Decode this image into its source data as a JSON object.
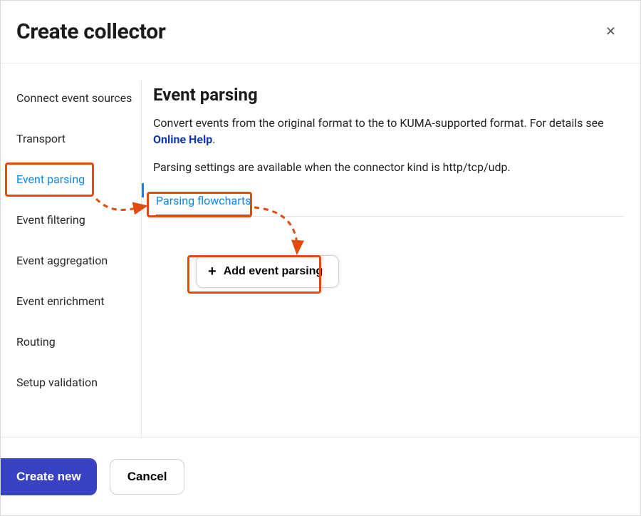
{
  "header": {
    "title": "Create collector",
    "close_label": "✕"
  },
  "sidebar": {
    "items": [
      {
        "label": "Connect event sources",
        "active": false
      },
      {
        "label": "Transport",
        "active": false
      },
      {
        "label": "Event parsing",
        "active": true
      },
      {
        "label": "Event filtering",
        "active": false
      },
      {
        "label": "Event aggregation",
        "active": false
      },
      {
        "label": "Event enrichment",
        "active": false
      },
      {
        "label": "Routing",
        "active": false
      },
      {
        "label": "Setup validation",
        "active": false
      }
    ]
  },
  "content": {
    "heading": "Event parsing",
    "description_pre": "Convert events from the original format to the to KUMA-supported format. For details see ",
    "description_link": "Online Help",
    "description_post": ".",
    "note": "Parsing settings are available when the connector kind is http/tcp/udp.",
    "tab_label": "Parsing flowcharts",
    "add_button_label": "Add event parsing"
  },
  "footer": {
    "primary_label": "Create new",
    "secondary_label": "Cancel"
  },
  "annotation": {
    "color": "#e24a0e"
  }
}
